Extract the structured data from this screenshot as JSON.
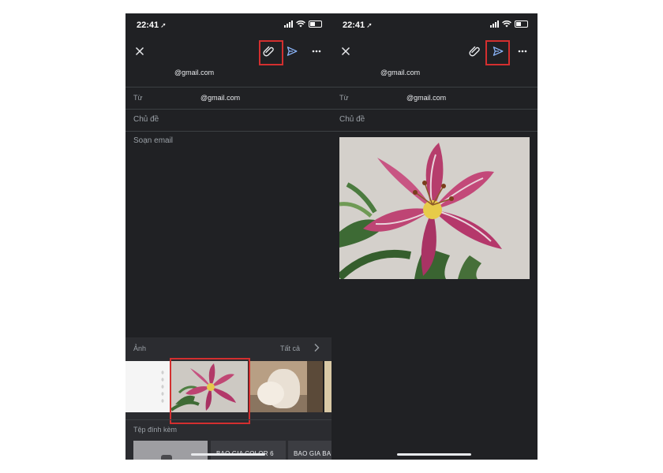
{
  "status": {
    "time": "22:41"
  },
  "compose": {
    "to_email": "@gmail.com",
    "from_label": "Từ",
    "from_email": "@gmail.com",
    "subject_placeholder": "Chủ đề",
    "body_placeholder": "Soạn email"
  },
  "picker": {
    "photos_title": "Ảnh",
    "see_all": "Tất cả",
    "attachments_title": "Tệp đính kèm",
    "files": [
      "BAO GIA COLOR 6",
      "BAO GIA BAU"
    ]
  },
  "icons": {
    "close": "close-icon",
    "attach": "paperclip-icon",
    "send": "send-icon",
    "more": "more-icon"
  },
  "colors": {
    "background": "#202124",
    "highlight": "#d32f2f",
    "send_accent": "#8ab4f8"
  }
}
